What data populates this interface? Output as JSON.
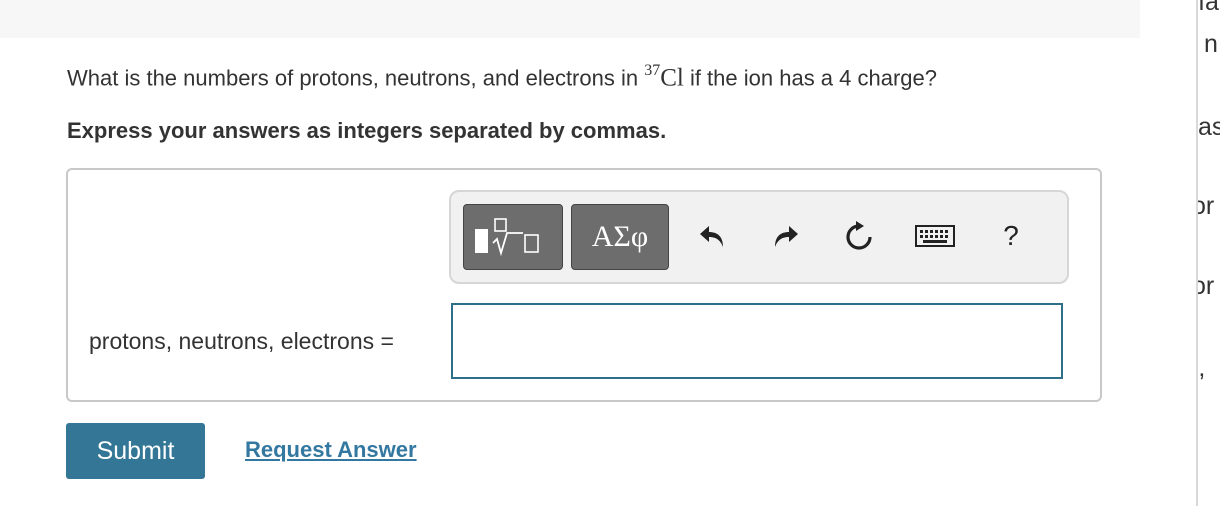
{
  "question": {
    "prefix": "What is the numbers of protons, neutrons, and electrons in ",
    "mass_number": "37",
    "element": "Cl",
    "suffix": " if the ion has a 4 charge?"
  },
  "instruction": "Express your answers as integers separated by commas.",
  "toolbar": {
    "greek_label": "ΑΣφ",
    "help_label": "?",
    "buttons": [
      "templates-icon",
      "undo-icon",
      "redo-icon",
      "reset-icon",
      "keyboard-icon",
      "help-icon"
    ]
  },
  "answer": {
    "label": "protons, neutrons, electrons =",
    "value": "",
    "placeholder": ""
  },
  "actions": {
    "submit_label": "Submit",
    "request_label": "Request Answer"
  },
  "right_strip": [
    "ıa",
    "n",
    "as",
    "or",
    "or",
    "),"
  ],
  "colors": {
    "accent": "#337695",
    "link": "#3378a0",
    "toolbar_button": "#6d6d6d",
    "input_border": "#2e6f8a"
  }
}
